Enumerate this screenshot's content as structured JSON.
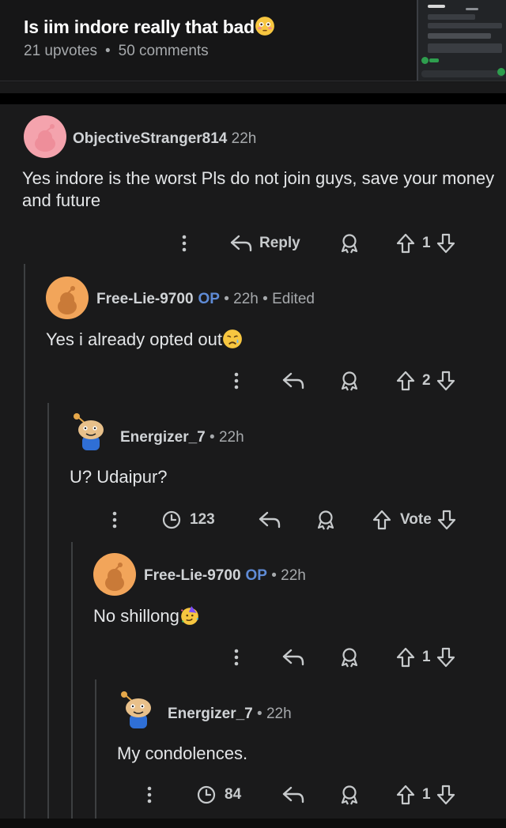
{
  "post": {
    "title": "Is iim indore really that bad",
    "upvotes": "21 upvotes",
    "separator": "•",
    "comments": "50 comments"
  },
  "thumbnail": {
    "lines": [
      "Not at all",
      "It's the worst performing Old IIM",
      "Their placement data is a fraud",
      "Indore is known for its misleading placement reports",
      "Message"
    ]
  },
  "comments": [
    {
      "author": "ObjectiveStranger814",
      "meta": " 22h",
      "op": "",
      "text": "Yes indore is the worst Pls do not join guys, save your money and future",
      "reply_label": "Reply",
      "votes": "1",
      "avatar_color": "#f4a3ad"
    },
    {
      "author": "Free-Lie-9700",
      "op": "OP",
      "meta": " • 22h • Edited",
      "text": "Yes i already opted out",
      "votes": "2",
      "avatar_color": "#f2a55a"
    },
    {
      "author": "Energizer_7",
      "op": "",
      "meta": " • 22h",
      "text": "U? Udaipur?",
      "views": "123",
      "votes": "Vote"
    },
    {
      "author": "Free-Lie-9700",
      "op": "OP",
      "meta": " • 22h",
      "text": "No shillong",
      "votes": "1",
      "avatar_color": "#f2a55a"
    },
    {
      "author": "Energizer_7",
      "op": "",
      "meta": " • 22h",
      "text": "My condolences.",
      "views": "84",
      "votes": "1"
    }
  ],
  "icons": {
    "more": "more-vertical-icon",
    "reply": "reply-arrow-icon",
    "award": "award-icon",
    "upvote": "upvote-arrow-icon",
    "downvote": "downvote-arrow-icon",
    "views": "views-clock-icon"
  },
  "colors": {
    "background": "#1a1a1b",
    "op_badge": "#5f8bd6",
    "text": "#e4e6e8"
  }
}
